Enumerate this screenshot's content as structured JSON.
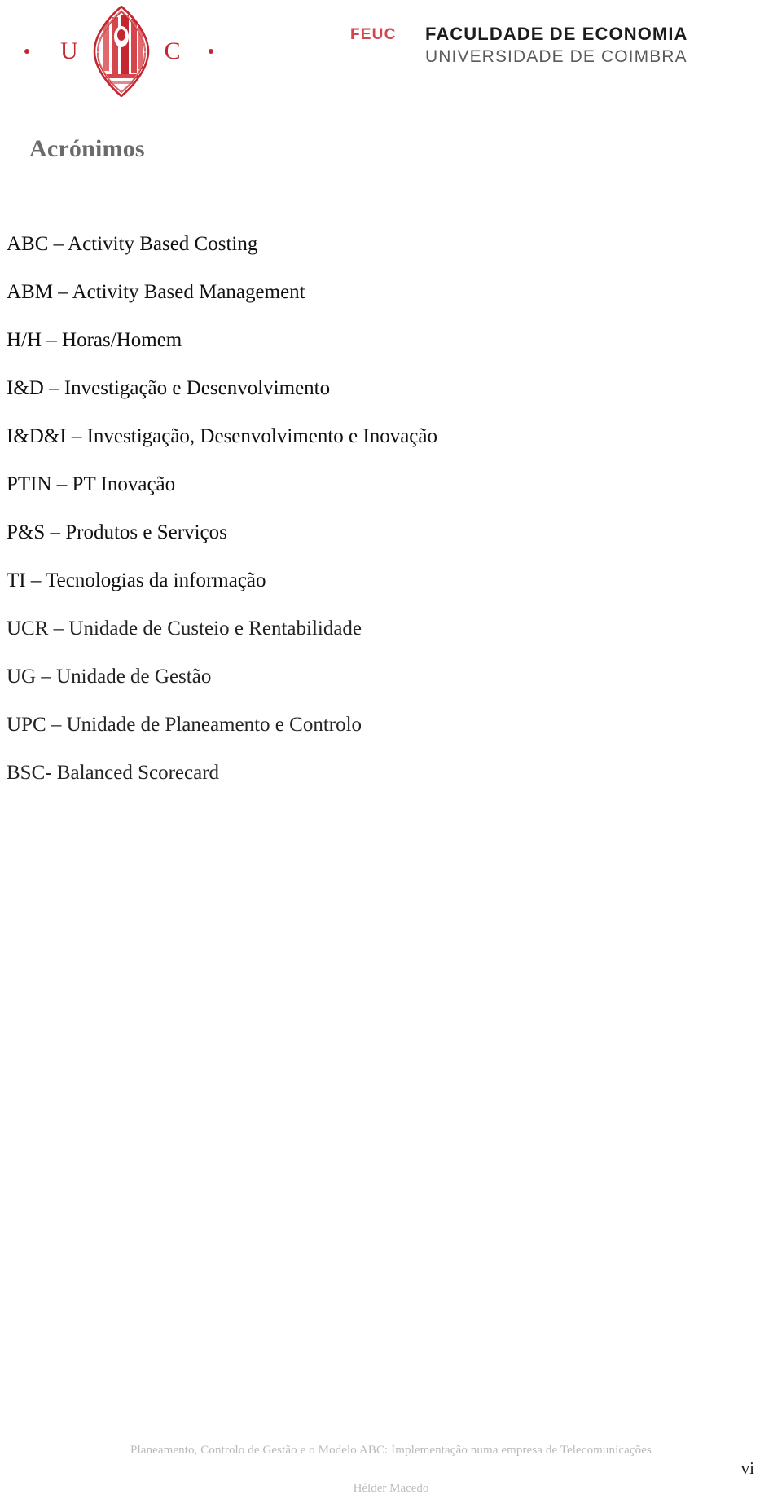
{
  "header": {
    "uc_logo": {
      "left_dot": "•",
      "letter_u": "U",
      "letter_c": "C",
      "right_dot": "•",
      "seal_alt": "Universidade de Coimbra seal"
    },
    "feuc": {
      "mark": "FEUC",
      "line1": "FACULDADE DE ECONOMIA",
      "line2": "UNIVERSIDADE DE COIMBRA"
    },
    "colors": {
      "brand_red": "#c4272f",
      "mark_red": "#d4464c",
      "dark": "#1c1c1c",
      "gray": "#5a5a5a"
    }
  },
  "section": {
    "title": "Acrónimos",
    "title_color": "#6b6b6b"
  },
  "acronyms": [
    {
      "text": "ABC – Activity Based Costing"
    },
    {
      "text": "ABM – Activity Based Management"
    },
    {
      "text": "H/H – Horas/Homem"
    },
    {
      "text": "I&D – Investigação e Desenvolvimento"
    },
    {
      "text": "I&D&I – Investigação, Desenvolvimento e Inovação"
    },
    {
      "text": "PTIN – PT Inovação"
    },
    {
      "text": "P&S – Produtos e Serviços"
    },
    {
      "text": "TI – Tecnologias da informação"
    },
    {
      "text": "UCR – Unidade de Custeio e Rentabilidade"
    },
    {
      "text": "UG – Unidade de Gestão"
    },
    {
      "text": "UPC – Unidade de Planeamento e Controlo"
    },
    {
      "text": "BSC- Balanced Scorecard"
    }
  ],
  "footer": {
    "title": "Planeamento, Controlo de Gestão e o Modelo ABC: Implementação numa empresa de Telecomunicações",
    "author": "Hélder Macedo",
    "page_number": "vi"
  }
}
